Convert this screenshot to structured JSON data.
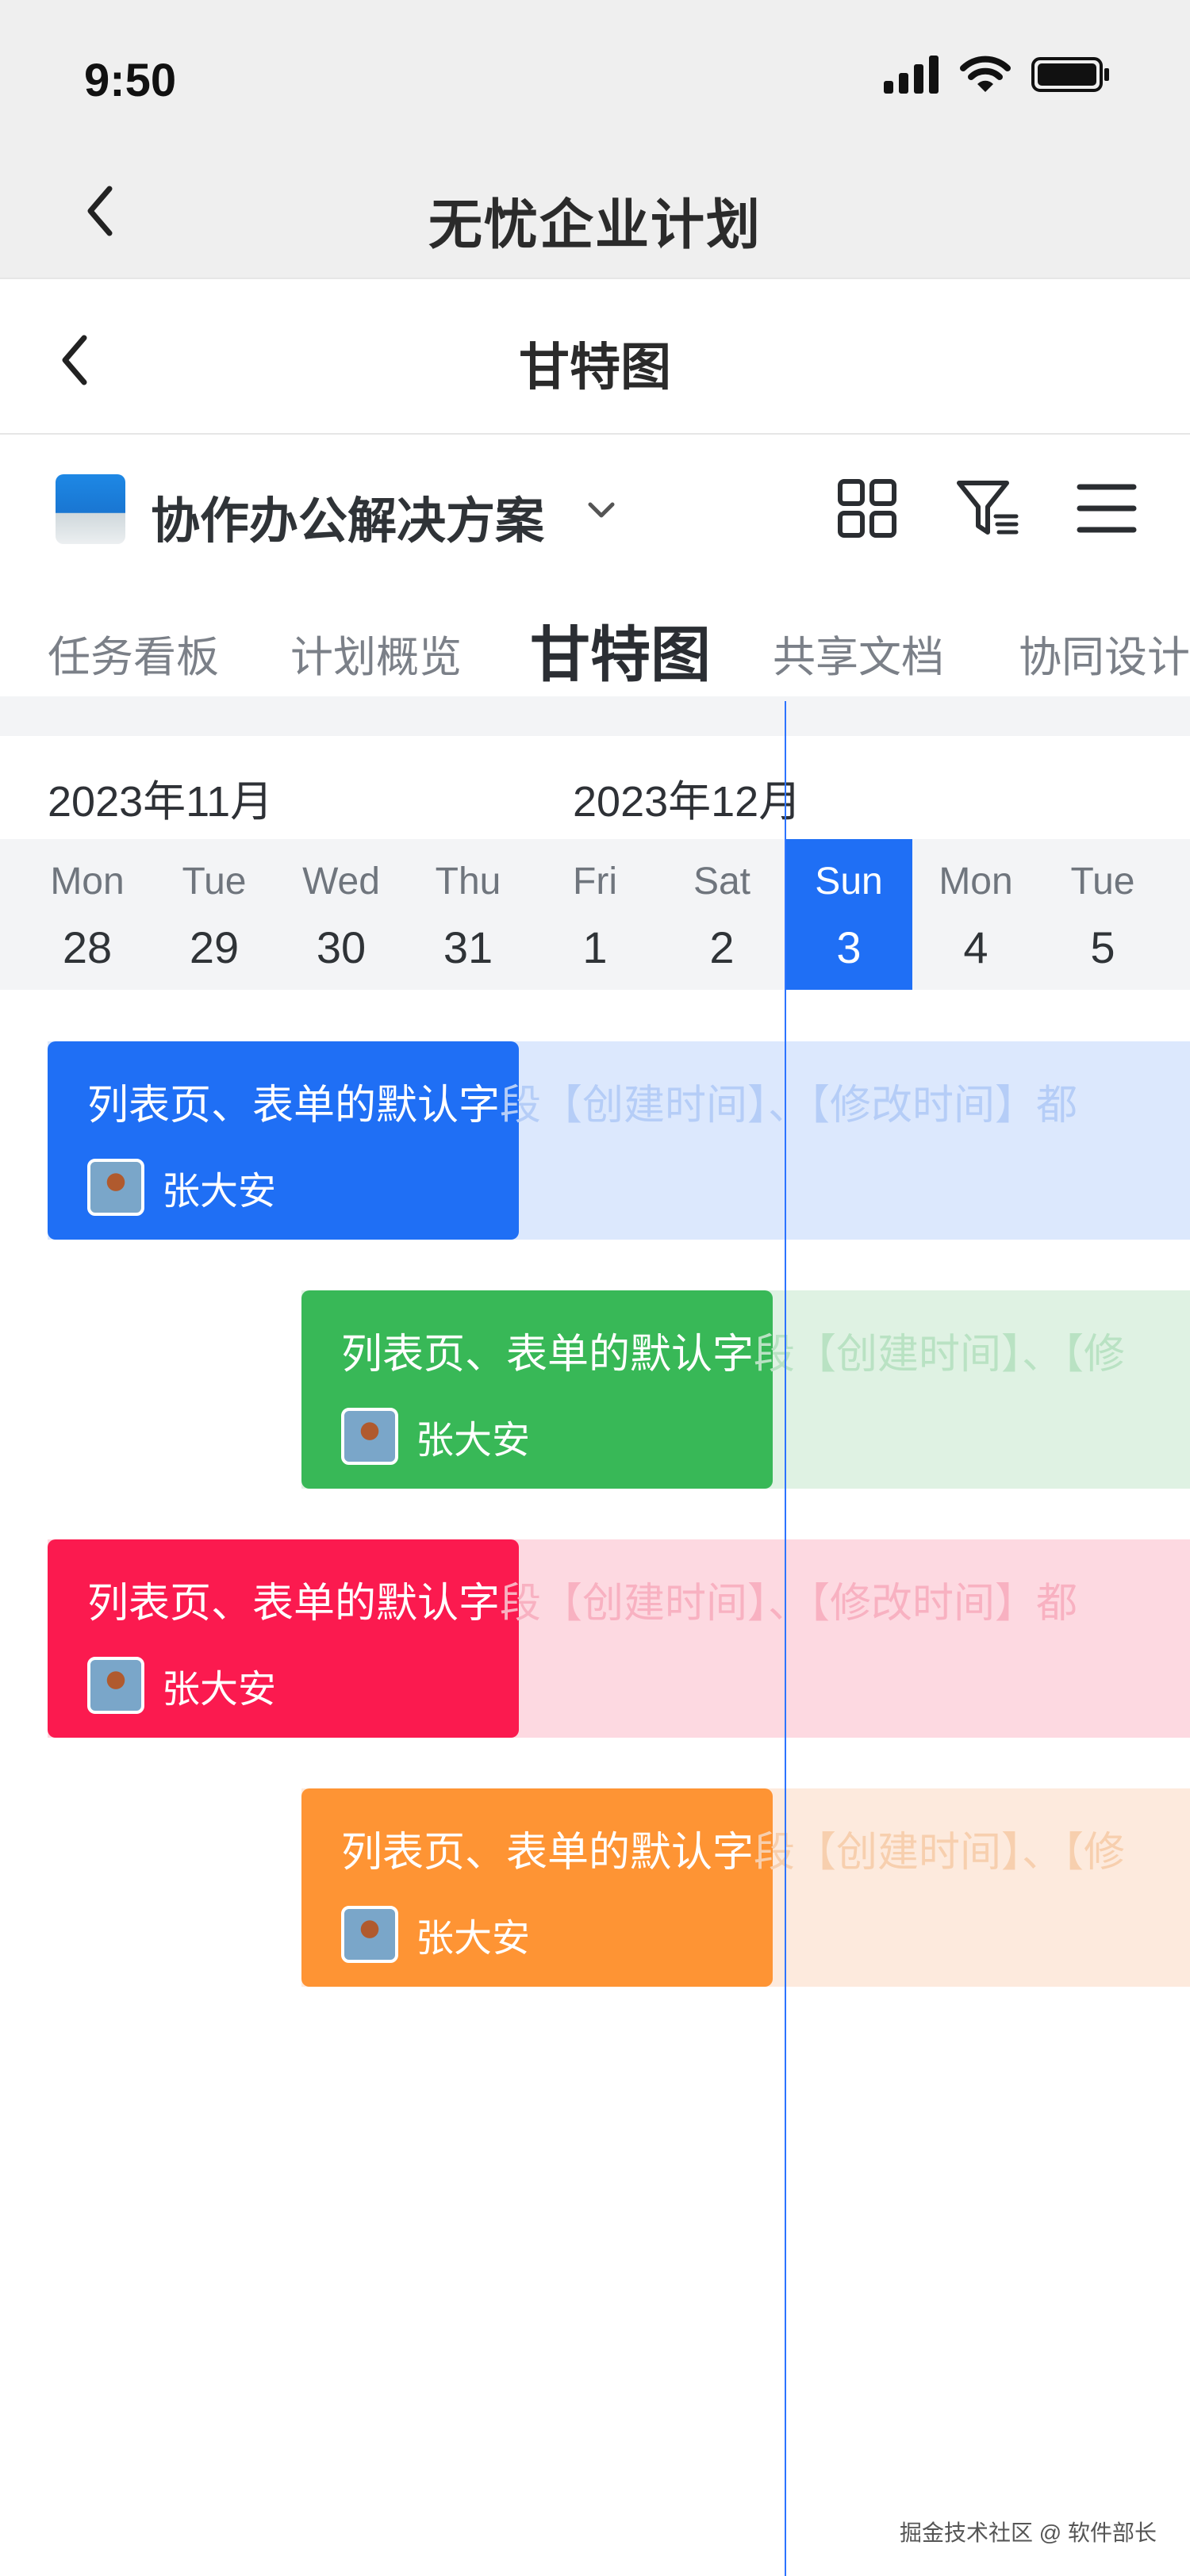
{
  "status_bar": {
    "time": "9:50"
  },
  "app_header": {
    "title": "无忧企业计划"
  },
  "page_header": {
    "title": "甘特图"
  },
  "project": {
    "name": "协作办公解决方案"
  },
  "tabs": [
    {
      "label": "任务看板"
    },
    {
      "label": "计划概览"
    },
    {
      "label": "甘特图",
      "active": true
    },
    {
      "label": "共享文档"
    },
    {
      "label": "协同设计"
    }
  ],
  "gantt": {
    "months": [
      "2023年11月",
      "2023年12月"
    ],
    "days": [
      {
        "name": "Mon",
        "date": "28"
      },
      {
        "name": "Tue",
        "date": "29"
      },
      {
        "name": "Wed",
        "date": "30"
      },
      {
        "name": "Thu",
        "date": "31"
      },
      {
        "name": "Fri",
        "date": "1"
      },
      {
        "name": "Sat",
        "date": "2"
      },
      {
        "name": "Sun",
        "date": "3",
        "today": true
      },
      {
        "name": "Mon",
        "date": "4"
      },
      {
        "name": "Tue",
        "date": "5"
      }
    ],
    "tasks": [
      {
        "title_in": "列表页、表单的默认字",
        "title_out": "段【创建时间】、【修改时间】都",
        "assignee": "张大安",
        "color": "#1f6ff5",
        "light": "#dce8fd",
        "text_light": "#b5cdf7"
      },
      {
        "title_in": "列表页、表单的默认字",
        "title_out": "段【创建时间】、【修",
        "assignee": "张大安",
        "color": "#38b857",
        "light": "#dff2e3",
        "text_light": "#b9e2c3"
      },
      {
        "title_in": "列表页、表单的默认字",
        "title_out": "段【创建时间】、【修改时间】都",
        "assignee": "张大安",
        "color": "#fb1a4f",
        "light": "#fdd9e1",
        "text_light": "#f8b1c1"
      },
      {
        "title_in": "列表页、表单的默认字",
        "title_out": "段【创建时间】、【修",
        "assignee": "张大安",
        "color": "#fe9434",
        "light": "#fdeadd",
        "text_light": "#f7cfae"
      }
    ]
  },
  "watermark": "掘金技术社区 @ 软件部长"
}
